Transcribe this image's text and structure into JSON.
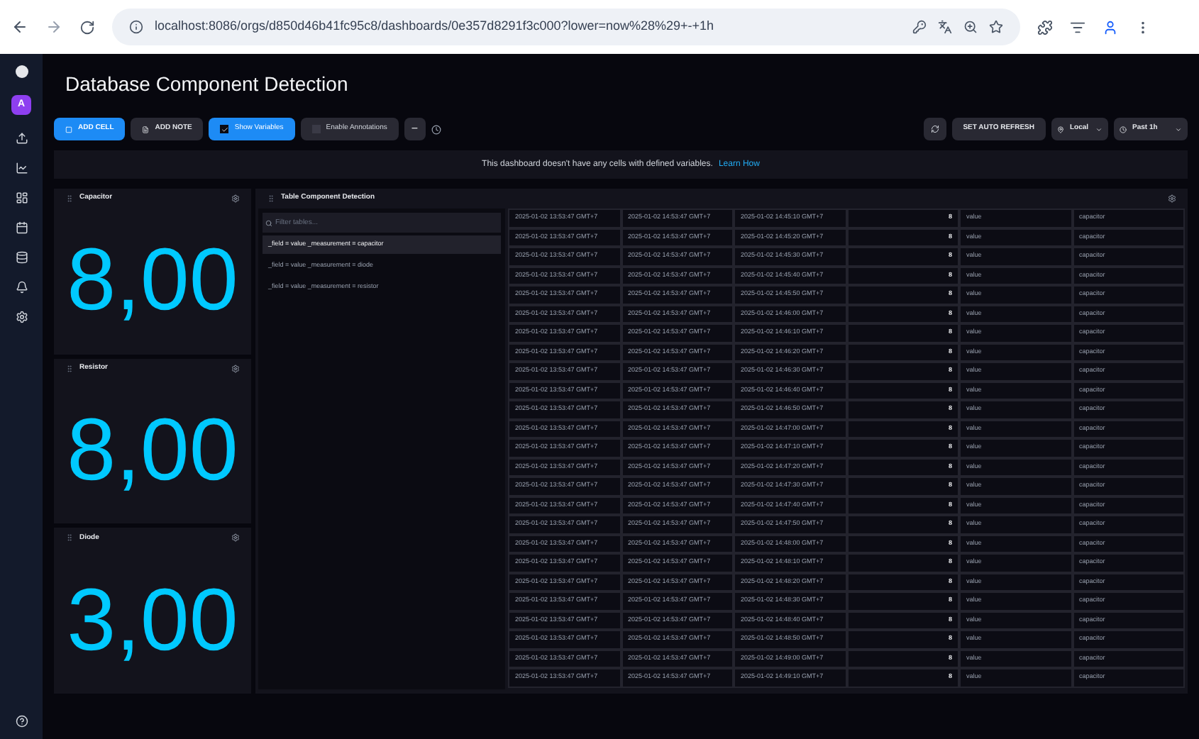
{
  "browser": {
    "url": "localhost:8086/orgs/d850d46b41fc95c8/dashboards/0e357d8291f3c000?lower=now%28%29+-+1h"
  },
  "sidebar": {
    "avatar": "A"
  },
  "title": "Database Component Detection",
  "toolbar": {
    "add_cell": "ADD CELL",
    "add_note": "ADD NOTE",
    "show_variables": {
      "label": "Show Variables",
      "checked": true
    },
    "enable_annotations": {
      "label": "Enable Annotations",
      "checked": false
    },
    "zoom_out": "−",
    "auto_refresh": "SET AUTO REFRESH",
    "timezone": "Local",
    "range": "Past 1h"
  },
  "banner": {
    "text": "This dashboard doesn't have any cells with defined variables.",
    "link": "Learn How"
  },
  "stat_cells": [
    {
      "title": "Capacitor",
      "value": "8,00"
    },
    {
      "title": "Resistor",
      "value": "8,00"
    },
    {
      "title": "Diode",
      "value": "3,00"
    }
  ],
  "table_cell": {
    "title": "Table Component Detection",
    "filter_placeholder": "Filter tables...",
    "tables": [
      {
        "label": "_field = value _measurement = capacitor",
        "selected": true
      },
      {
        "label": "_field = value _measurement = diode",
        "selected": false
      },
      {
        "label": "_field = value _measurement = resistor",
        "selected": false
      }
    ],
    "rows": [
      [
        "2025-01-02 13:53:47 GMT+7",
        "2025-01-02 14:53:47 GMT+7",
        "2025-01-02 14:45:10 GMT+7",
        "8",
        "value",
        "capacitor"
      ],
      [
        "2025-01-02 13:53:47 GMT+7",
        "2025-01-02 14:53:47 GMT+7",
        "2025-01-02 14:45:20 GMT+7",
        "8",
        "value",
        "capacitor"
      ],
      [
        "2025-01-02 13:53:47 GMT+7",
        "2025-01-02 14:53:47 GMT+7",
        "2025-01-02 14:45:30 GMT+7",
        "8",
        "value",
        "capacitor"
      ],
      [
        "2025-01-02 13:53:47 GMT+7",
        "2025-01-02 14:53:47 GMT+7",
        "2025-01-02 14:45:40 GMT+7",
        "8",
        "value",
        "capacitor"
      ],
      [
        "2025-01-02 13:53:47 GMT+7",
        "2025-01-02 14:53:47 GMT+7",
        "2025-01-02 14:45:50 GMT+7",
        "8",
        "value",
        "capacitor"
      ],
      [
        "2025-01-02 13:53:47 GMT+7",
        "2025-01-02 14:53:47 GMT+7",
        "2025-01-02 14:46:00 GMT+7",
        "8",
        "value",
        "capacitor"
      ],
      [
        "2025-01-02 13:53:47 GMT+7",
        "2025-01-02 14:53:47 GMT+7",
        "2025-01-02 14:46:10 GMT+7",
        "8",
        "value",
        "capacitor"
      ],
      [
        "2025-01-02 13:53:47 GMT+7",
        "2025-01-02 14:53:47 GMT+7",
        "2025-01-02 14:46:20 GMT+7",
        "8",
        "value",
        "capacitor"
      ],
      [
        "2025-01-02 13:53:47 GMT+7",
        "2025-01-02 14:53:47 GMT+7",
        "2025-01-02 14:46:30 GMT+7",
        "8",
        "value",
        "capacitor"
      ],
      [
        "2025-01-02 13:53:47 GMT+7",
        "2025-01-02 14:53:47 GMT+7",
        "2025-01-02 14:46:40 GMT+7",
        "8",
        "value",
        "capacitor"
      ],
      [
        "2025-01-02 13:53:47 GMT+7",
        "2025-01-02 14:53:47 GMT+7",
        "2025-01-02 14:46:50 GMT+7",
        "8",
        "value",
        "capacitor"
      ],
      [
        "2025-01-02 13:53:47 GMT+7",
        "2025-01-02 14:53:47 GMT+7",
        "2025-01-02 14:47:00 GMT+7",
        "8",
        "value",
        "capacitor"
      ],
      [
        "2025-01-02 13:53:47 GMT+7",
        "2025-01-02 14:53:47 GMT+7",
        "2025-01-02 14:47:10 GMT+7",
        "8",
        "value",
        "capacitor"
      ],
      [
        "2025-01-02 13:53:47 GMT+7",
        "2025-01-02 14:53:47 GMT+7",
        "2025-01-02 14:47:20 GMT+7",
        "8",
        "value",
        "capacitor"
      ],
      [
        "2025-01-02 13:53:47 GMT+7",
        "2025-01-02 14:53:47 GMT+7",
        "2025-01-02 14:47:30 GMT+7",
        "8",
        "value",
        "capacitor"
      ],
      [
        "2025-01-02 13:53:47 GMT+7",
        "2025-01-02 14:53:47 GMT+7",
        "2025-01-02 14:47:40 GMT+7",
        "8",
        "value",
        "capacitor"
      ],
      [
        "2025-01-02 13:53:47 GMT+7",
        "2025-01-02 14:53:47 GMT+7",
        "2025-01-02 14:47:50 GMT+7",
        "8",
        "value",
        "capacitor"
      ],
      [
        "2025-01-02 13:53:47 GMT+7",
        "2025-01-02 14:53:47 GMT+7",
        "2025-01-02 14:48:00 GMT+7",
        "8",
        "value",
        "capacitor"
      ],
      [
        "2025-01-02 13:53:47 GMT+7",
        "2025-01-02 14:53:47 GMT+7",
        "2025-01-02 14:48:10 GMT+7",
        "8",
        "value",
        "capacitor"
      ],
      [
        "2025-01-02 13:53:47 GMT+7",
        "2025-01-02 14:53:47 GMT+7",
        "2025-01-02 14:48:20 GMT+7",
        "8",
        "value",
        "capacitor"
      ],
      [
        "2025-01-02 13:53:47 GMT+7",
        "2025-01-02 14:53:47 GMT+7",
        "2025-01-02 14:48:30 GMT+7",
        "8",
        "value",
        "capacitor"
      ],
      [
        "2025-01-02 13:53:47 GMT+7",
        "2025-01-02 14:53:47 GMT+7",
        "2025-01-02 14:48:40 GMT+7",
        "8",
        "value",
        "capacitor"
      ],
      [
        "2025-01-02 13:53:47 GMT+7",
        "2025-01-02 14:53:47 GMT+7",
        "2025-01-02 14:48:50 GMT+7",
        "8",
        "value",
        "capacitor"
      ],
      [
        "2025-01-02 13:53:47 GMT+7",
        "2025-01-02 14:53:47 GMT+7",
        "2025-01-02 14:49:00 GMT+7",
        "8",
        "value",
        "capacitor"
      ],
      [
        "2025-01-02 13:53:47 GMT+7",
        "2025-01-02 14:53:47 GMT+7",
        "2025-01-02 14:49:10 GMT+7",
        "8",
        "value",
        "capacitor"
      ]
    ]
  }
}
